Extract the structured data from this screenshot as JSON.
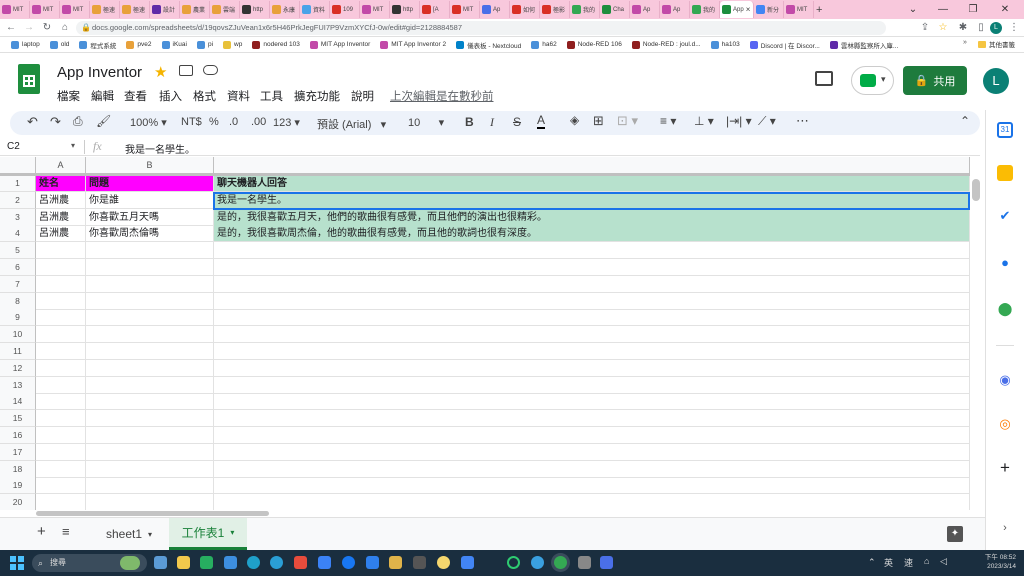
{
  "browser": {
    "tabs": [
      {
        "label": "MIT",
        "color": "#c24aa8"
      },
      {
        "label": "MIT",
        "color": "#c24aa8"
      },
      {
        "label": "MIT",
        "color": "#c24aa8"
      },
      {
        "label": "極速",
        "color": "#e8a13a"
      },
      {
        "label": "極速",
        "color": "#e8a13a"
      },
      {
        "label": "設計",
        "color": "#5f2aa8"
      },
      {
        "label": "農業",
        "color": "#e8a13a"
      },
      {
        "label": "雲端",
        "color": "#e8a13a"
      },
      {
        "label": "http",
        "color": "#333333"
      },
      {
        "label": "永康",
        "color": "#e8a13a"
      },
      {
        "label": "資料",
        "color": "#4aa3e8"
      },
      {
        "label": "109",
        "color": "#d93025"
      },
      {
        "label": "MIT",
        "color": "#c24aa8"
      },
      {
        "label": "http",
        "color": "#333333"
      },
      {
        "label": "[A",
        "color": "#d93025"
      },
      {
        "label": "MIT",
        "color": "#d93025"
      },
      {
        "label": "Ap",
        "color": "#4a6fe8"
      },
      {
        "label": "如何",
        "color": "#d93025"
      },
      {
        "label": "極影",
        "color": "#d93025"
      },
      {
        "label": "我的",
        "color": "#34a853"
      },
      {
        "label": "Cha",
        "color": "#1e8e3e"
      },
      {
        "label": "Ap",
        "color": "#c24aa8"
      },
      {
        "label": "Ap",
        "color": "#c24aa8"
      },
      {
        "label": "我的",
        "color": "#34a853"
      },
      {
        "label": "App",
        "color": "#1e8e3e"
      },
      {
        "label": "新分",
        "color": "#4285f4"
      },
      {
        "label": "MIT",
        "color": "#c24aa8"
      }
    ],
    "active_tab_index": 24,
    "url": "docs.google.com/spreadsheets/d/19qovsZJuVean1x6r5H46PrkJegFUI7P9VzmXYCfJ-0w/edit#gid=2128884587",
    "bookmarks": [
      {
        "label": "laptop",
        "color": "#4a90d9"
      },
      {
        "label": "old",
        "color": "#4a90d9"
      },
      {
        "label": "程式系統",
        "color": "#4a90d9"
      },
      {
        "label": "pve2",
        "color": "#e8a13a"
      },
      {
        "label": "iKuai",
        "color": "#4a90d9"
      },
      {
        "label": "pi",
        "color": "#4a90d9"
      },
      {
        "label": "wp",
        "color": "#e8c13a"
      },
      {
        "label": "nodered 103",
        "color": "#8f1e1e"
      },
      {
        "label": "MIT App Inventor",
        "color": "#c24aa8"
      },
      {
        "label": "MIT App Inventor 2",
        "color": "#c24aa8"
      },
      {
        "label": "儀表板 - Nextcloud",
        "color": "#0082c9"
      },
      {
        "label": "ha62",
        "color": "#4a90d9"
      },
      {
        "label": "Node-RED 106",
        "color": "#8f1e1e"
      },
      {
        "label": "Node-RED : joul.d...",
        "color": "#8f1e1e"
      },
      {
        "label": "ha103",
        "color": "#4a90d9"
      },
      {
        "label": "Discord | 在 Discor...",
        "color": "#5865f2"
      },
      {
        "label": "雲林縣監察所入庫...",
        "color": "#5f2aa8"
      }
    ],
    "bookmarks_more": "其他書籤"
  },
  "app": {
    "doc_title": "App Inventor",
    "menu": [
      "檔案",
      "編輯",
      "查看",
      "插入",
      "格式",
      "資料",
      "工具",
      "擴充功能",
      "說明"
    ],
    "last_edit": "上次編輯是在數秒前",
    "share_label": "共用",
    "avatar_letter": "L"
  },
  "toolbar": {
    "zoom": "100%",
    "currency": "NT$",
    "percent": "%",
    "dec_decrease": ".0",
    "dec_increase": ".00",
    "more_formats": "123",
    "font": "預設 (Arial)",
    "font_size": "10",
    "more": "⋯"
  },
  "formula_bar": {
    "cell_ref": "C2",
    "fx": "fx",
    "content": "我是一名學生。"
  },
  "sheet": {
    "columns": [
      "A",
      "B"
    ],
    "row_numbers": [
      "1",
      "2",
      "3",
      "4",
      "5",
      "6",
      "7",
      "8",
      "9",
      "10",
      "11",
      "12",
      "13",
      "14",
      "15",
      "16",
      "17",
      "18",
      "19",
      "20"
    ],
    "rows": [
      [
        "姓名",
        "問題",
        "聊天機器人回答"
      ],
      [
        "呂洲農",
        "你是誰",
        "我是一名學生。"
      ],
      [
        "呂洲農",
        "你喜歡五月天嗎",
        "是的，我很喜歡五月天，他們的歌曲很有感覺，而且他們的演出也很精彩。"
      ],
      [
        "呂洲農",
        "你喜歡周杰倫嗎",
        "是的，我很喜歡周杰倫，他的歌曲很有感覺，而且他的歌詞也很有深度。"
      ]
    ],
    "header_color_ab": "#ff00ff",
    "header_color_c": "#b7e1cd",
    "data_color_c": "#b7e1cd"
  },
  "sheet_tabs": {
    "tabs": [
      "sheet1",
      "工作表1"
    ],
    "active_index": 1
  },
  "taskbar": {
    "search_label": "搜尋",
    "ime_1": "英",
    "ime_2": "速",
    "time": "下午 08:52",
    "date": "2023/3/14"
  }
}
